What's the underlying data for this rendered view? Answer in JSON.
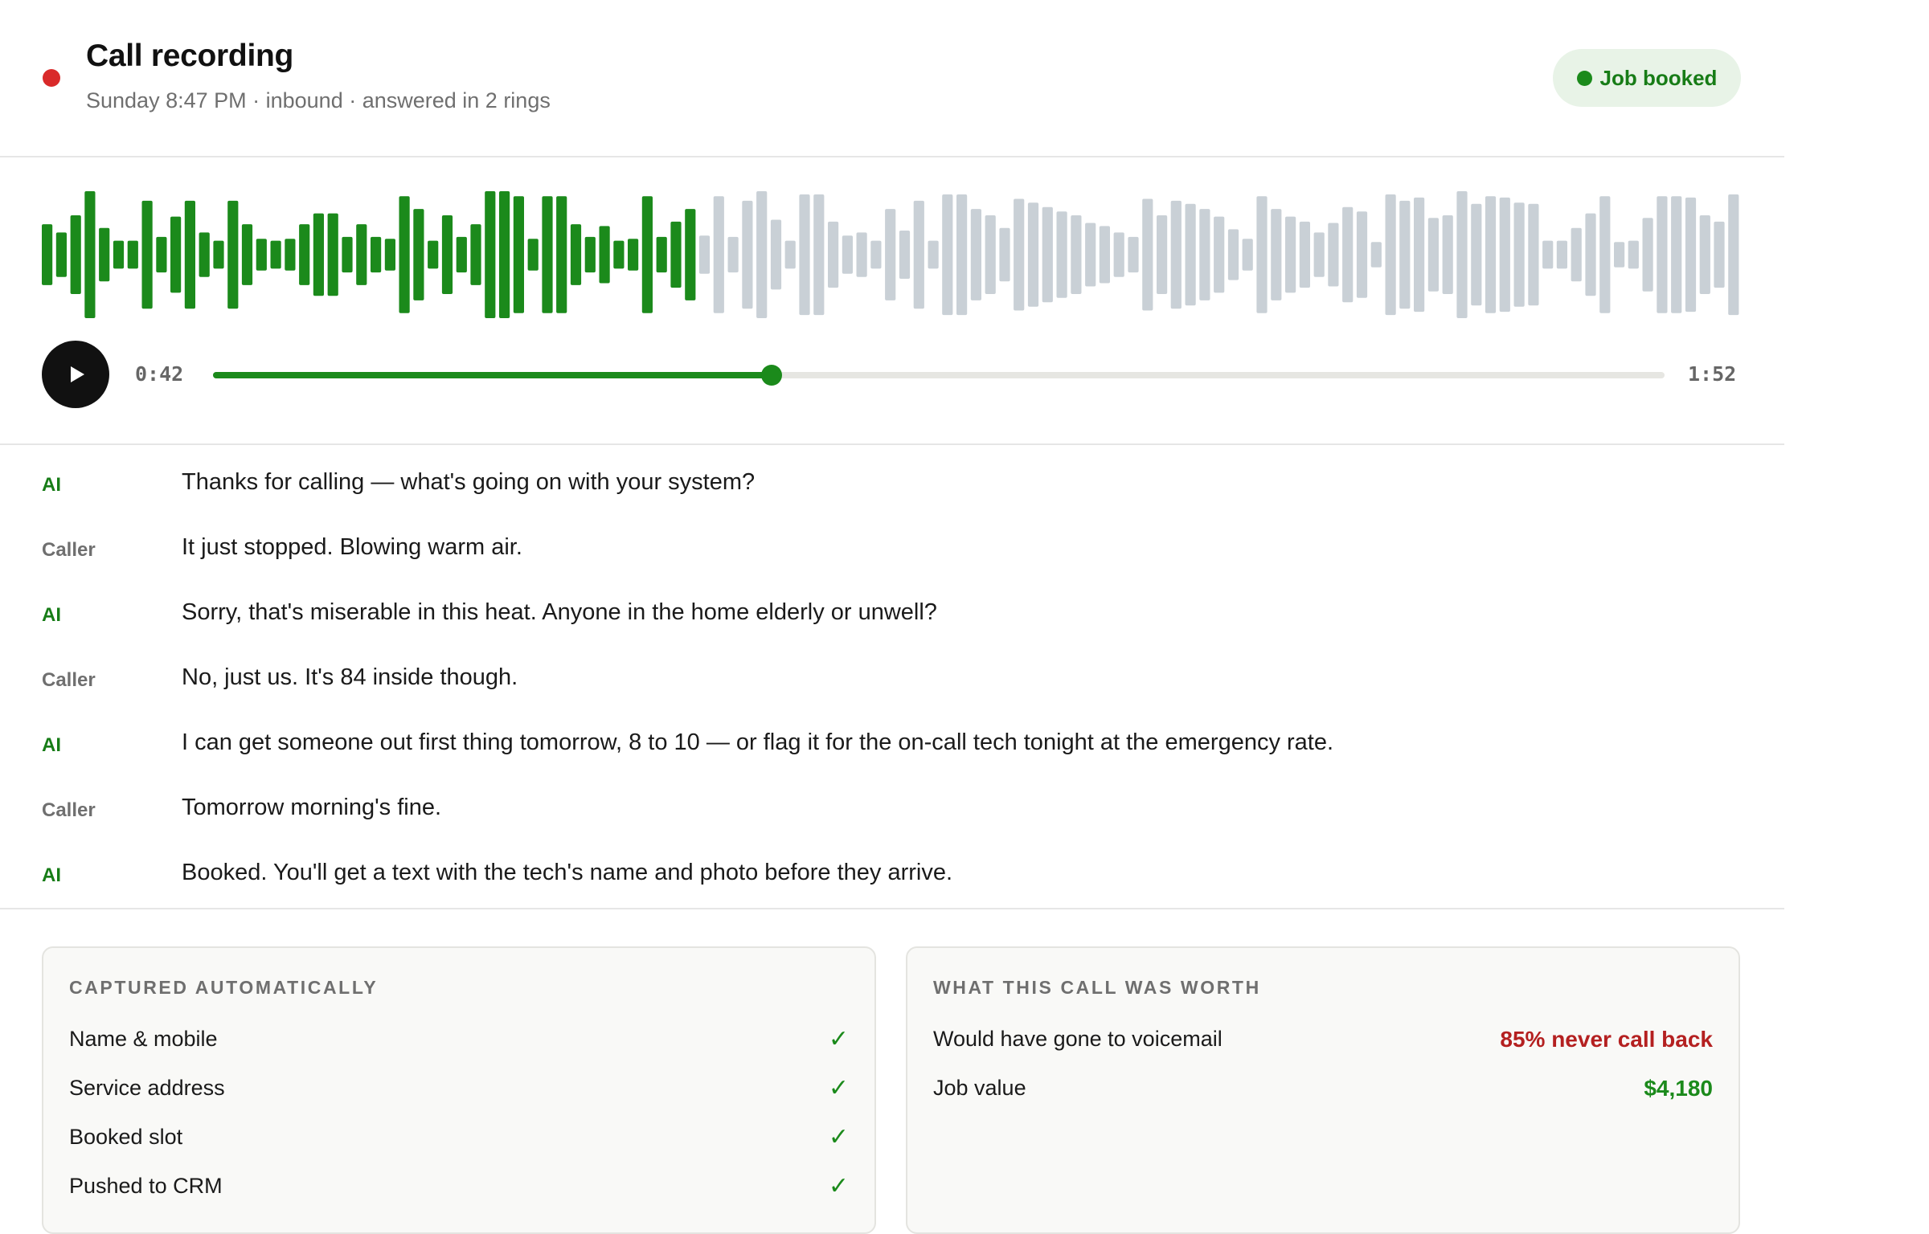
{
  "header": {
    "title": "Call recording",
    "subtitle": "Sunday 8:47 PM · inbound · answered in 2 rings",
    "badge": "Job booked"
  },
  "player": {
    "current_time": "0:42",
    "total_time": "1:52",
    "progress": 0.385,
    "colors": {
      "played": "#1b8a1b",
      "unplayed": "#c9d0d6"
    },
    "bar_levels": [
      0.48,
      0.35,
      0.62,
      1.0,
      0.42,
      0.22,
      0.22,
      0.85,
      0.28,
      0.6,
      0.85,
      0.35,
      0.22,
      0.85,
      0.48,
      0.25,
      0.22,
      0.25,
      0.48,
      0.65,
      0.65,
      0.28,
      0.48,
      0.28,
      0.25,
      0.92,
      0.72,
      0.22,
      0.62,
      0.28,
      0.48,
      1.0,
      1.0,
      0.92,
      0.25,
      0.92,
      0.92,
      0.48,
      0.28,
      0.45,
      0.22,
      0.25,
      0.92,
      0.28,
      0.52,
      0.72,
      0.3,
      0.92,
      0.28,
      0.85,
      1.0,
      0.55,
      0.22,
      0.95,
      0.95,
      0.52,
      0.3,
      0.35,
      0.22,
      0.72,
      0.38,
      0.85,
      0.22,
      0.95,
      0.95,
      0.72,
      0.62,
      0.42,
      0.88,
      0.82,
      0.75,
      0.68,
      0.62,
      0.5,
      0.45,
      0.35,
      0.28,
      0.88,
      0.62,
      0.85,
      0.8,
      0.72,
      0.6,
      0.4,
      0.25,
      0.92,
      0.72,
      0.6,
      0.52,
      0.35,
      0.5,
      0.75,
      0.68,
      0.2,
      0.95,
      0.85,
      0.9,
      0.58,
      0.62,
      1.0,
      0.8,
      0.92,
      0.9,
      0.82,
      0.8,
      0.22,
      0.22,
      0.42,
      0.65,
      0.92,
      0.2,
      0.22,
      0.58,
      0.92,
      0.92,
      0.9,
      0.62,
      0.52,
      0.95
    ]
  },
  "transcript": [
    {
      "speaker": "AI",
      "text": "Thanks for calling — what's going on with your system?"
    },
    {
      "speaker": "Caller",
      "text": "It just stopped. Blowing warm air."
    },
    {
      "speaker": "AI",
      "text": "Sorry, that's miserable in this heat. Anyone in the home elderly or unwell?"
    },
    {
      "speaker": "Caller",
      "text": "No, just us. It's 84 inside though."
    },
    {
      "speaker": "AI",
      "text": "I can get someone out first thing tomorrow, 8 to 10 — or flag it for the on-call tech tonight at the emergency rate."
    },
    {
      "speaker": "Caller",
      "text": "Tomorrow morning's fine."
    },
    {
      "speaker": "AI",
      "text": "Booked. You'll get a text with the tech's name and photo before they arrive."
    }
  ],
  "captured": {
    "title": "CAPTURED AUTOMATICALLY",
    "check_glyph": "✓",
    "items": [
      "Name & mobile",
      "Service address",
      "Booked slot",
      "Pushed to CRM"
    ]
  },
  "worth": {
    "title": "WHAT THIS CALL WAS WORTH",
    "rows": [
      {
        "label": "Would have gone to voicemail",
        "value": "85% never call back",
        "color": "red"
      },
      {
        "label": "Job value",
        "value": "$4,180",
        "color": "green"
      }
    ]
  }
}
